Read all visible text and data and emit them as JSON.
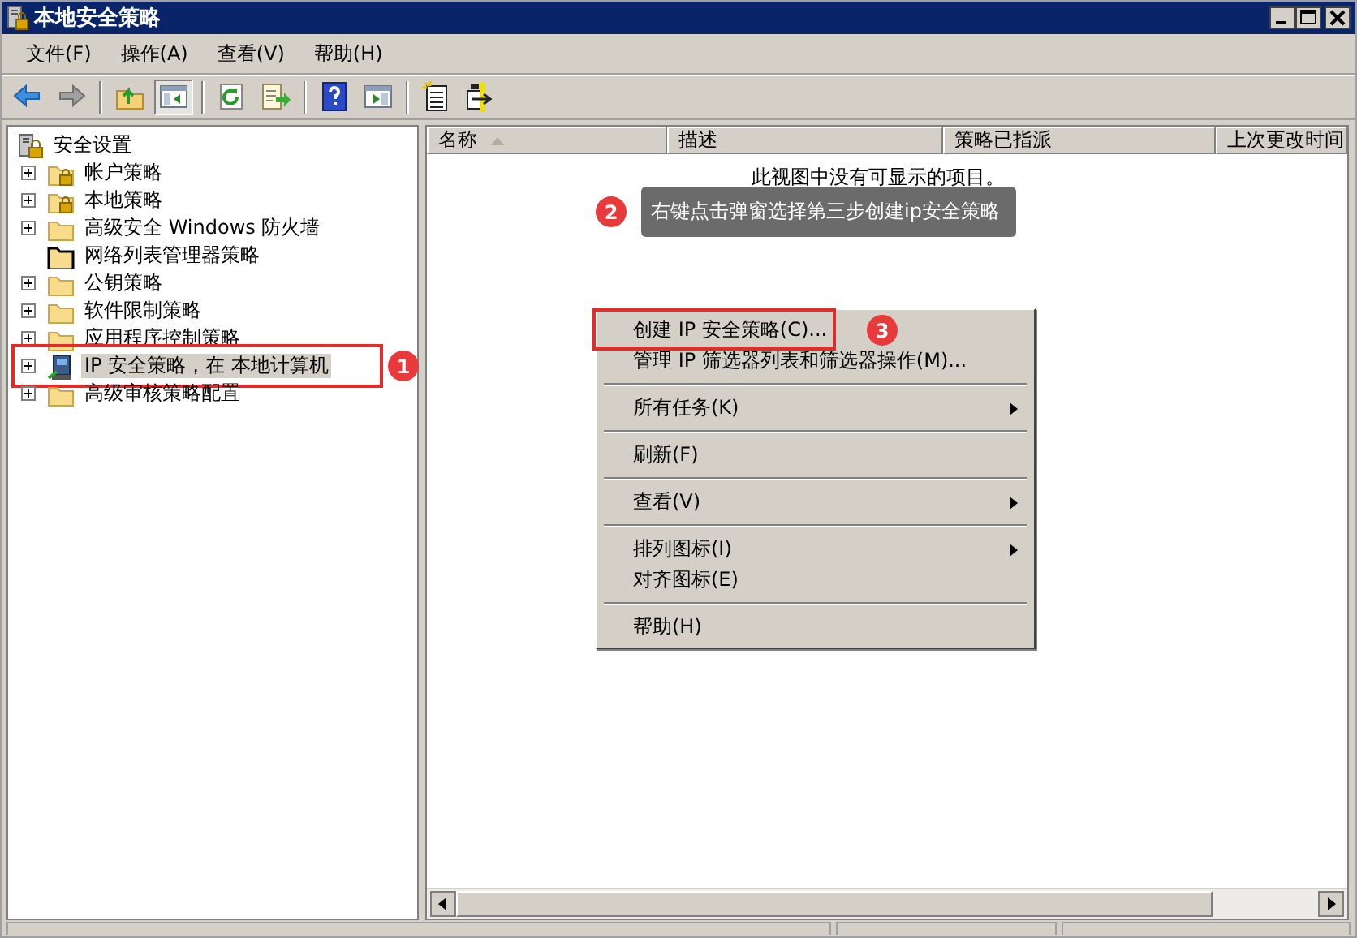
{
  "window": {
    "title": "本地安全策略"
  },
  "menu": [
    {
      "label": "文件(F)"
    },
    {
      "label": "操作(A)"
    },
    {
      "label": "查看(V)"
    },
    {
      "label": "帮助(H)"
    }
  ],
  "toolbar": [
    {
      "pressed": false
    },
    {
      "pressed": false
    },
    {
      "pressed": false
    },
    {
      "pressed": true
    },
    {
      "pressed": false
    },
    {
      "pressed": false
    },
    {
      "pressed": false
    },
    {
      "pressed": false
    },
    {
      "pressed": false
    },
    {
      "pressed": false
    }
  ],
  "tree": {
    "label": "安全设置",
    "children": [
      {
        "label": "帐户策略",
        "kind": "locked-folder",
        "expandable": true,
        "selected": false
      },
      {
        "label": "本地策略",
        "kind": "locked-folder",
        "expandable": true,
        "selected": false
      },
      {
        "label": "高级安全 Windows 防火墙",
        "kind": "folder",
        "expandable": true,
        "selected": false
      },
      {
        "label": "网络列表管理器策略",
        "kind": "outlined-folder",
        "expandable": false,
        "selected": false
      },
      {
        "label": "公钥策略",
        "kind": "folder",
        "expandable": true,
        "selected": false
      },
      {
        "label": "软件限制策略",
        "kind": "folder",
        "expandable": true,
        "selected": false
      },
      {
        "label": "应用程序控制策略",
        "kind": "folder",
        "expandable": true,
        "selected": false
      },
      {
        "label": "IP 安全策略，在 本地计算机",
        "kind": "computer",
        "expandable": true,
        "selected": true,
        "annotation": "1"
      },
      {
        "label": "高级审核策略配置",
        "kind": "folder",
        "expandable": true,
        "selected": false
      }
    ]
  },
  "list": {
    "columns": [
      {
        "label": "名称",
        "sorted": true
      },
      {
        "label": "描述",
        "sorted": false
      },
      {
        "label": "策略已指派",
        "sorted": false
      },
      {
        "label": "上次更改时间",
        "sorted": false
      }
    ],
    "empty_text": "此视图中没有可显示的项目。",
    "callout": {
      "number": "2",
      "text": "右键点击弹窗选择第三步创建ip安全策略"
    }
  },
  "context_menu": {
    "groups": [
      [
        {
          "label": "创建 IP 安全策略(C)...",
          "submenu": false,
          "annotation": "3"
        },
        {
          "label": "管理 IP 筛选器列表和筛选器操作(M)...",
          "submenu": false
        }
      ],
      [
        {
          "label": "所有任务(K)",
          "submenu": true
        }
      ],
      [
        {
          "label": "刷新(F)",
          "submenu": false
        }
      ],
      [
        {
          "label": "查看(V)",
          "submenu": true
        }
      ],
      [
        {
          "label": "排列图标(I)",
          "submenu": true
        },
        {
          "label": "对齐图标(E)",
          "submenu": false
        }
      ],
      [
        {
          "label": "帮助(H)",
          "submenu": false
        }
      ]
    ]
  }
}
